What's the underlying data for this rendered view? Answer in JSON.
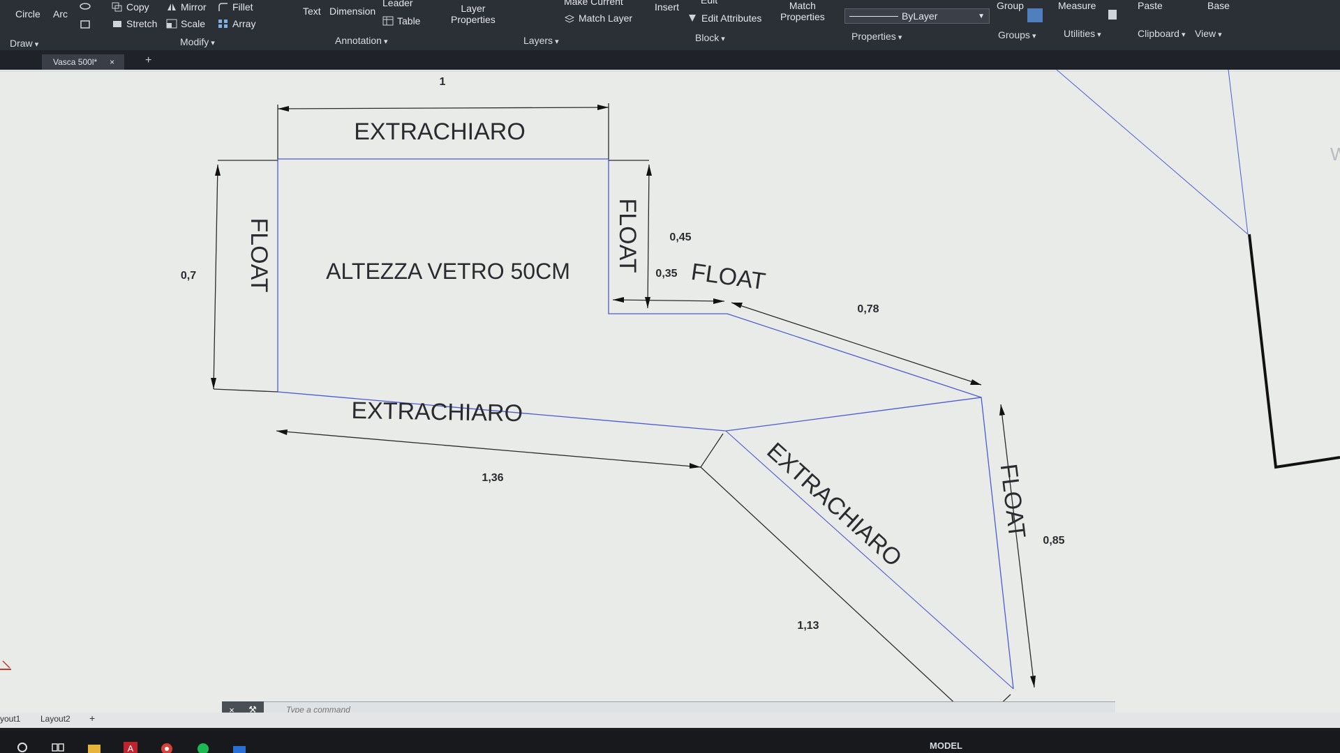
{
  "ribbon": {
    "draw": {
      "circle": "Circle",
      "arc": "Arc",
      "group": "Draw"
    },
    "modify": {
      "copy": "Copy",
      "mirror": "Mirror",
      "fillet": "Fillet",
      "stretch": "Stretch",
      "scale": "Scale",
      "array": "Array",
      "group": "Modify"
    },
    "annotation": {
      "text": "Text",
      "dimension": "Dimension",
      "leader": "Leader",
      "table": "Table",
      "group": "Annotation"
    },
    "layers": {
      "layer_properties_1": "Layer",
      "layer_properties_2": "Properties",
      "make_current": "Make Current",
      "match_layer": "Match Layer",
      "group": "Layers"
    },
    "block": {
      "insert": "Insert",
      "edit": "Edit",
      "edit_attributes": "Edit Attributes",
      "group": "Block"
    },
    "properties": {
      "match_1": "Match",
      "match_2": "Properties",
      "bylayer": "ByLayer",
      "group": "Properties"
    },
    "groups": {
      "group_btn": "Group",
      "group": "Groups"
    },
    "utilities": {
      "measure": "Measure",
      "group": "Utilities"
    },
    "clipboard": {
      "paste": "Paste",
      "group": "Clipboard"
    },
    "view": {
      "base": "Base",
      "group": "View"
    }
  },
  "tabs": {
    "document": "Vasca 500l*",
    "new_tab": "+"
  },
  "drawing": {
    "labels": {
      "extrachiaro_top": "EXTRACHIARO",
      "float_left": "FLOAT",
      "center": "ALTEZZA VETRO 50CM",
      "float_mid": "FLOAT",
      "float_diag": "FLOAT",
      "extrachiaro_bottom": "EXTRACHIARO",
      "extrachiaro_diag": "EXTRACHIARO",
      "float_right": "FLOAT",
      "w_partial": "W"
    },
    "dimensions": {
      "top": "1",
      "left": "0,7",
      "d045": "0,45",
      "d035": "0,35",
      "d078": "0,78",
      "d136": "1,36",
      "d113": "1,13",
      "d085": "0,85"
    }
  },
  "command_line": {
    "placeholder": "Type a command"
  },
  "layout_tabs": {
    "layout1": "yout1",
    "layout2": "Layout2",
    "add": "+"
  },
  "status_bar": {
    "model": "MODEL"
  },
  "colors": {
    "blue_line": "#4a5bd4",
    "dim_line": "#2b2b2b",
    "canvas": "#e9ebe8",
    "ribbon": "#2b2f36"
  },
  "icons": {
    "windows": "search-icon",
    "taskview": "task-view-icon",
    "explorer": "folder-icon",
    "autocad": "autocad-icon",
    "chrome": "chrome-icon",
    "spotify": "spotify-icon",
    "outlook": "mail-icon"
  }
}
